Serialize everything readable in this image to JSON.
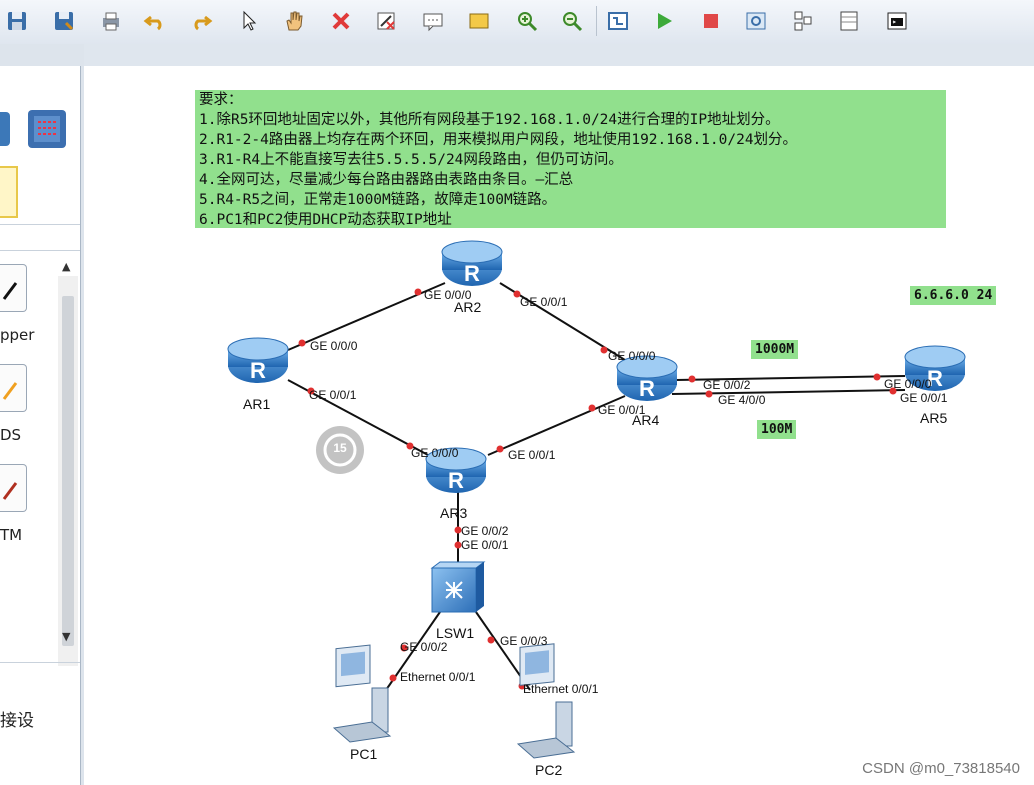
{
  "toolbar": {
    "icons": [
      "save-icon",
      "save-as-icon",
      "print-icon",
      "undo-icon",
      "redo-icon",
      "select-pointer-icon",
      "pan-hand-icon",
      "delete-icon",
      "clear-connections-icon",
      "text-note-icon",
      "rectangle-icon",
      "zoom-in-icon",
      "zoom-out-icon",
      "topology-icon",
      "start-device-icon",
      "stop-device-icon",
      "capture-icon",
      "cluster-icon",
      "grid-icon",
      "console-icon"
    ]
  },
  "left_panel": {
    "labels": [
      "pper",
      "DS",
      "TM"
    ],
    "footer_text": "接设"
  },
  "requirements": {
    "lines": [
      "要求：",
      "1.除R5环回地址固定以外，其他所有网段基于192.168.1.0/24进行合理的IP地址划分。",
      "2.R1-2-4路由器上均存在两个环回，用来模拟用户网段，地址使用192.168.1.0/24划分。",
      "3.R1-R4上不能直接写去往5.5.5.5/24网段路由，但仍可访问。",
      "4.全网可达，尽量减少每台路由器路由表路由条目。—汇总",
      "5.R4-R5之间，正常走1000M链路，故障走100M链路。",
      "6.PC1和PC2使用DHCP动态获取IP地址"
    ]
  },
  "devices": {
    "ar1": "AR1",
    "ar2": "AR2",
    "ar3": "AR3",
    "ar4": "AR4",
    "ar5": "AR5",
    "lsw1": "LSW1",
    "pc1": "PC1",
    "pc2": "PC2"
  },
  "ports": {
    "ar1_ge000": "GE 0/0/0",
    "ar1_ge001": "GE 0/0/1",
    "ar2_ge000": "GE 0/0/0",
    "ar2_ge001": "GE 0/0/1",
    "ar4_ge000": "GE 0/0/0",
    "ar4_ge002": "GE 0/0/2",
    "ar4_ge400": "GE 4/0/0",
    "ar4_ge001": "GE 0/0/1",
    "ar5_ge000": "GE 0/0/0",
    "ar5_ge001": "GE 0/0/1",
    "ar3_ge000": "GE 0/0/0",
    "ar3_ge001": "GE 0/0/1",
    "ar3_ge002": "GE 0/0/2",
    "lsw1_ge001": "GE 0/0/1",
    "lsw1_ge002": "GE 0/0/2",
    "lsw1_ge003": "GE 0/0/3",
    "pc1_eth": "Ethernet 0/0/1",
    "pc2_eth": "Ethernet 0/0/1"
  },
  "tags": {
    "net6": "6.6.6.0 24",
    "link1000": "1000M",
    "link100": "100M"
  },
  "overlay": {
    "replay_badge": "15"
  },
  "watermark": "CSDN @m0_73818540",
  "colors": {
    "note_bg": "#91e08d",
    "router_blue": "#2f7fc8",
    "link": "#111111",
    "port_dot": "#e03030"
  }
}
